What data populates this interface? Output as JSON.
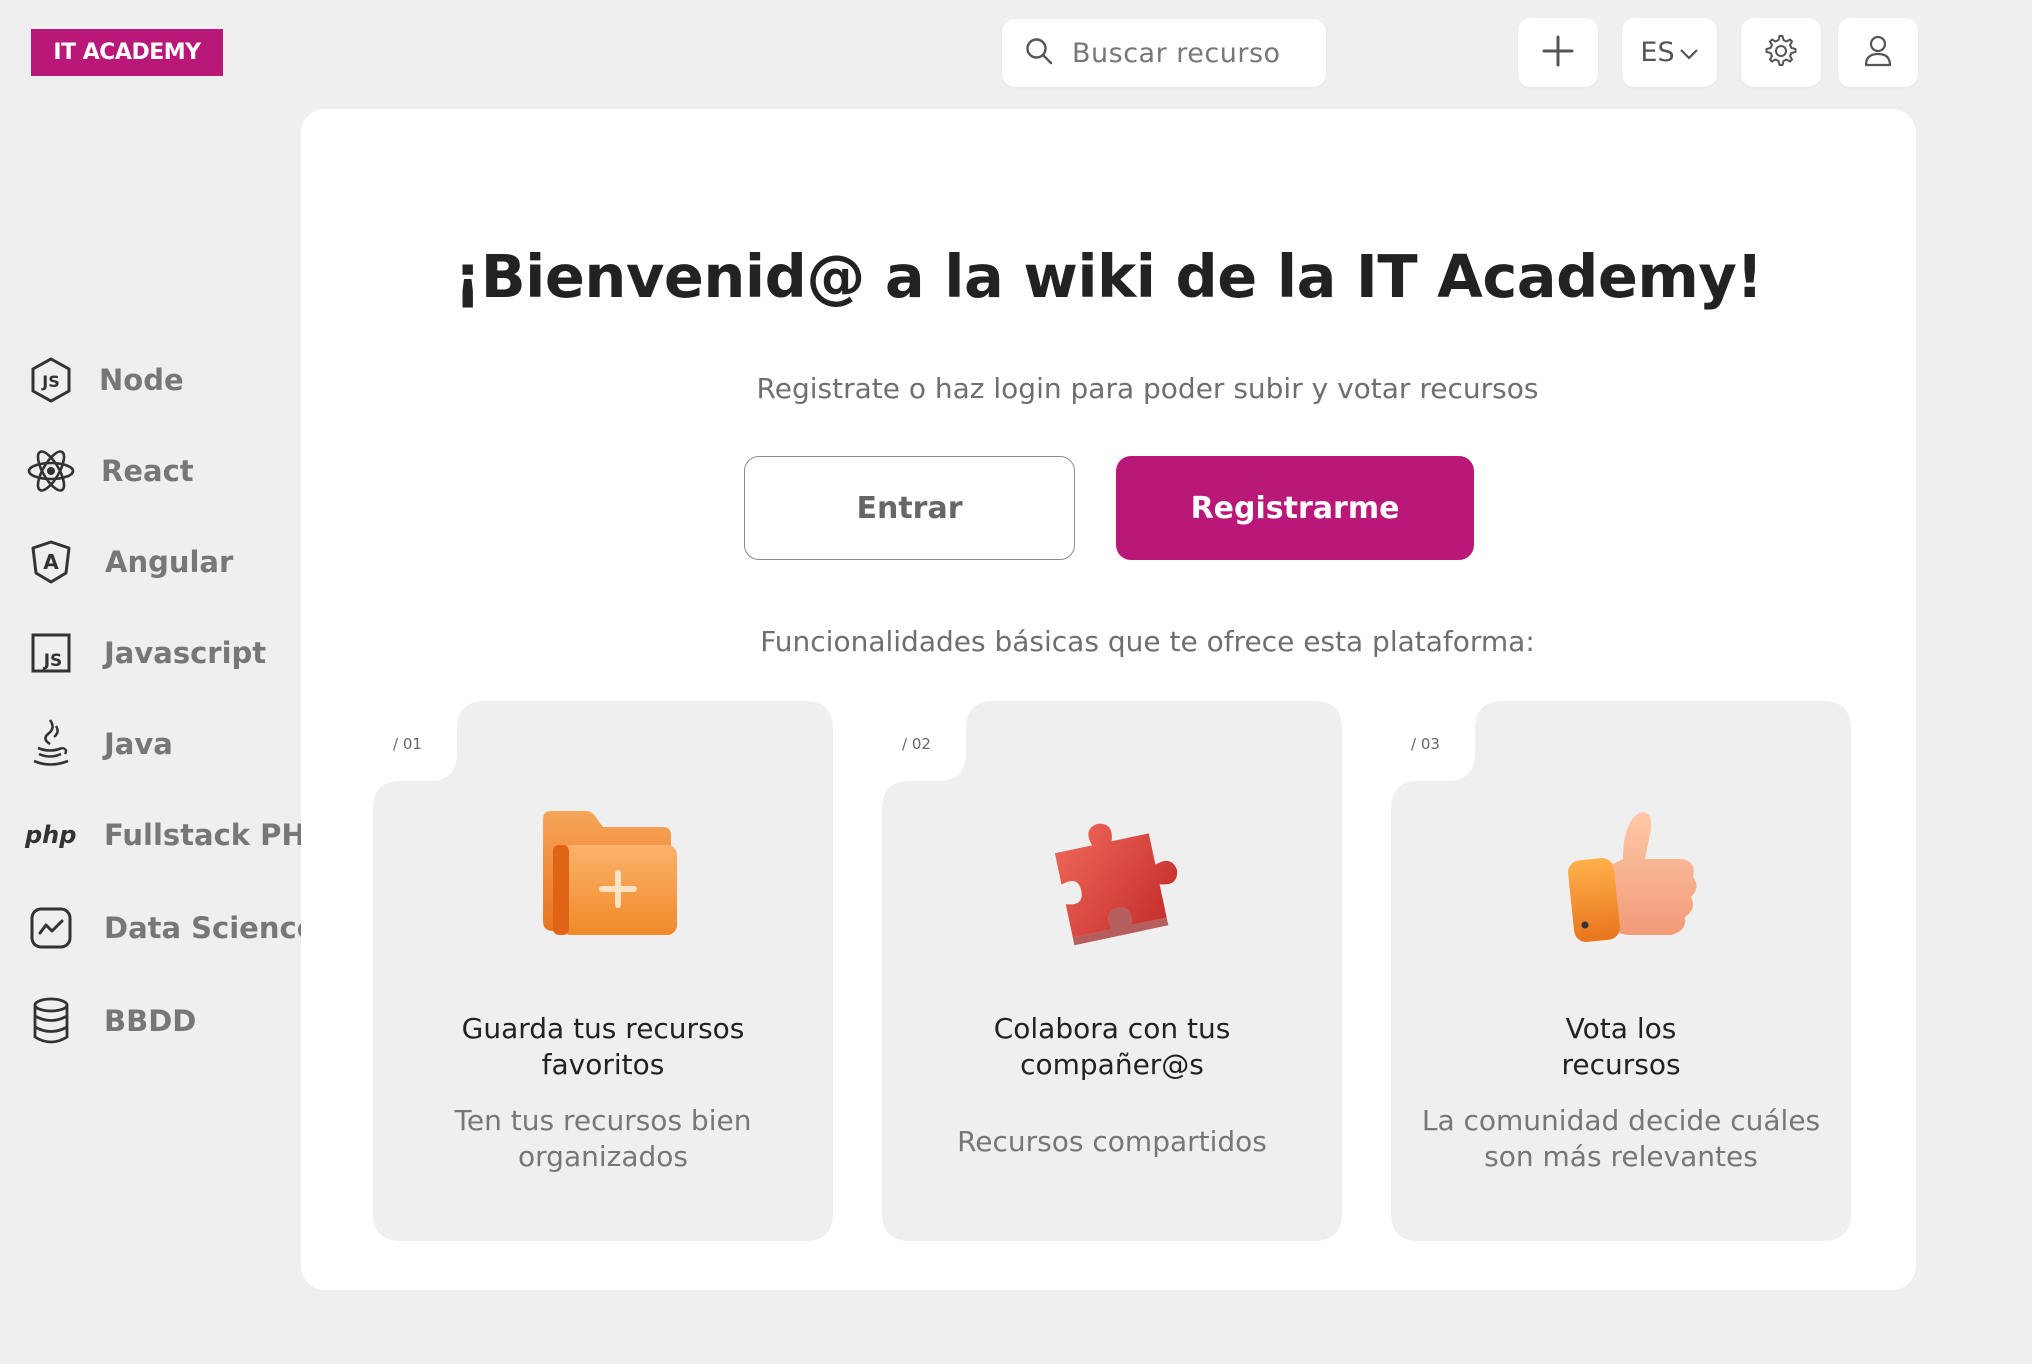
{
  "header": {
    "logo_text": "IT ACADEMY",
    "search_placeholder": "Buscar recurso",
    "language": "ES",
    "icons": [
      "search-icon",
      "plus-icon",
      "chevron-down-icon",
      "gear-icon",
      "user-icon"
    ]
  },
  "sidebar": {
    "items": [
      {
        "label": "Node",
        "icon": "node-js-icon"
      },
      {
        "label": "React",
        "icon": "react-icon"
      },
      {
        "label": "Angular",
        "icon": "angular-icon"
      },
      {
        "label": "Javascript",
        "icon": "javascript-icon"
      },
      {
        "label": "Java",
        "icon": "java-icon"
      },
      {
        "label": "Fullstack PHP",
        "icon": "php-icon",
        "icon_text": "php"
      },
      {
        "label": "Data Science",
        "icon": "data-science-icon"
      },
      {
        "label": "BBDD",
        "icon": "database-icon"
      }
    ]
  },
  "main": {
    "title": "¡Bienvenid@ a la wiki de la IT Academy!",
    "subtitle": "Registrate o  haz login para poder subir y votar recursos",
    "login_button": "Entrar",
    "register_button": "Registrarme",
    "features_title": "Funcionalidades básicas que te ofrece esta plataforma:",
    "cards": [
      {
        "number": "/ 01",
        "title_line1": "Guarda tus recursos",
        "title_line2": "favoritos",
        "desc_line1": "Ten tus recursos bien",
        "desc_line2": "organizados",
        "icon": "folder-plus-icon"
      },
      {
        "number": "/ 02",
        "title_line1": "Colabora con tus",
        "title_line2": "compañer@s",
        "desc_line1": "Recursos compartidos",
        "desc_line2": "",
        "icon": "puzzle-piece-icon"
      },
      {
        "number": "/ 03",
        "title_line1": "Vota los",
        "title_line2": "recursos",
        "desc_line1": "La comunidad decide cuáles",
        "desc_line2": "son más relevantes",
        "icon": "thumbs-up-icon"
      }
    ]
  },
  "colors": {
    "brand": "#b91879",
    "background": "#efefef",
    "card": "#efefef",
    "text_muted": "#777777"
  }
}
